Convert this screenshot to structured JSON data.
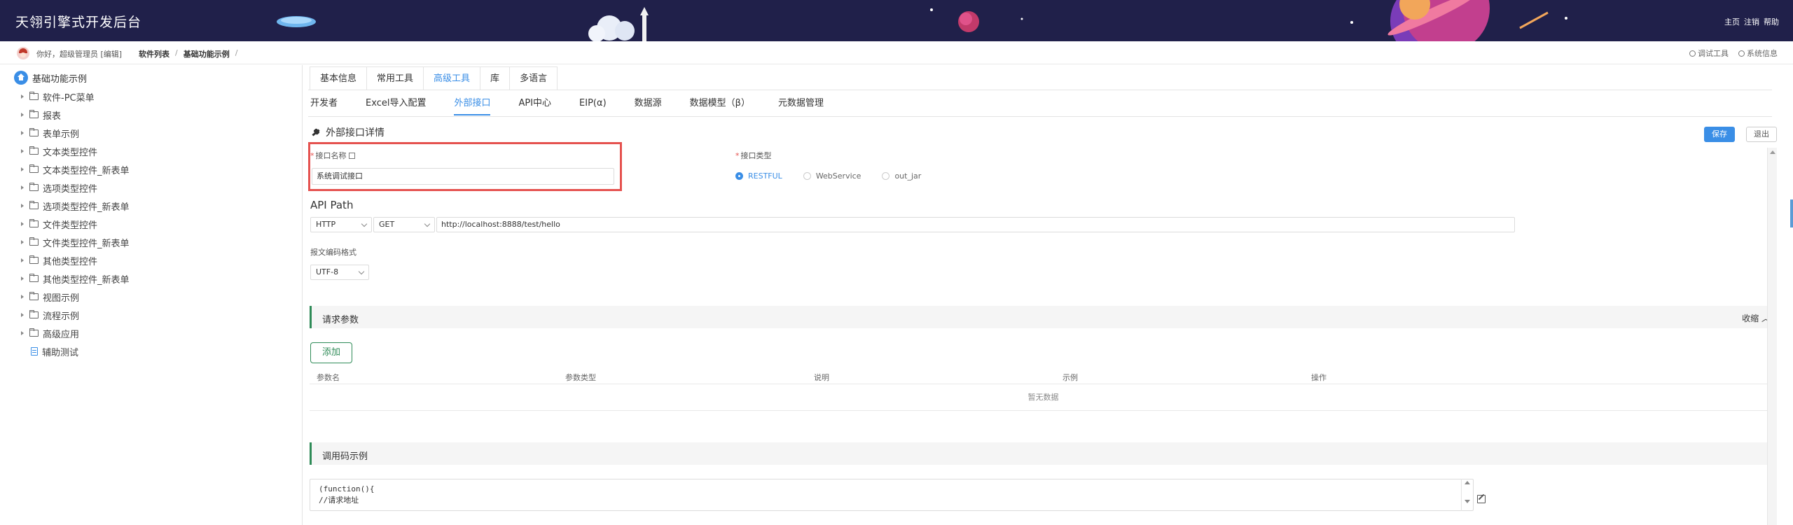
{
  "app": {
    "title": "天翎引擎式开发后台"
  },
  "header_links": [
    "主页",
    "注销",
    "帮助"
  ],
  "topbar": {
    "greeting": "你好，超级管理员 [编辑]",
    "breadcrumb": [
      "软件列表",
      "基础功能示例"
    ],
    "separators": [
      "/",
      "/"
    ],
    "tools": [
      {
        "label": "调试工具",
        "icon": "debug-icon"
      },
      {
        "label": "系统信息",
        "icon": "gear-icon"
      }
    ]
  },
  "sidebar": {
    "root": "基础功能示例",
    "items": [
      {
        "label": "软件-PC菜单",
        "icon": "folder-icon"
      },
      {
        "label": "报表",
        "icon": "folder-icon"
      },
      {
        "label": "表单示例",
        "icon": "folder-icon"
      },
      {
        "label": "文本类型控件",
        "icon": "folder-icon"
      },
      {
        "label": "文本类型控件_新表单",
        "icon": "folder-icon"
      },
      {
        "label": "选项类型控件",
        "icon": "folder-icon"
      },
      {
        "label": "选项类型控件_新表单",
        "icon": "folder-icon"
      },
      {
        "label": "文件类型控件",
        "icon": "folder-icon"
      },
      {
        "label": "文件类型控件_新表单",
        "icon": "folder-icon"
      },
      {
        "label": "其他类型控件",
        "icon": "folder-icon"
      },
      {
        "label": "其他类型控件_新表单",
        "icon": "folder-icon"
      },
      {
        "label": "视图示例",
        "icon": "folder-icon"
      },
      {
        "label": "流程示例",
        "icon": "folder-icon"
      },
      {
        "label": "高级应用",
        "icon": "folder-icon"
      },
      {
        "label": "辅助测试",
        "icon": "doc-icon"
      }
    ]
  },
  "tabs_primary": [
    {
      "label": "基本信息"
    },
    {
      "label": "常用工具"
    },
    {
      "label": "高级工具",
      "active": true
    },
    {
      "label": "库"
    },
    {
      "label": "多语言"
    }
  ],
  "tabs_secondary": [
    {
      "label": "开发者"
    },
    {
      "label": "Excel导入配置"
    },
    {
      "label": "外部接口",
      "active": true
    },
    {
      "label": "API中心"
    },
    {
      "label": "EIP(α)"
    },
    {
      "label": "数据源"
    },
    {
      "label": "数据模型（β）"
    },
    {
      "label": "元数据管理"
    }
  ],
  "detail": {
    "title": "外部接口详情",
    "save_label": "保存",
    "exit_label": "退出",
    "name_label": "接口名称",
    "name_value": "系统调试接口",
    "type_label": "接口类型",
    "type_options": [
      {
        "label": "RESTFUL",
        "selected": true
      },
      {
        "label": "WebService",
        "selected": false
      },
      {
        "label": "out_jar",
        "selected": false
      }
    ],
    "api_path_label": "API Path",
    "protocol": "HTTP",
    "method": "GET",
    "url": "http://localhost:8888/test/hello",
    "encoding_label": "报文编码格式",
    "encoding": "UTF-8"
  },
  "request_params": {
    "title": "请求参数",
    "collapse_label": "收缩",
    "add_label": "添加",
    "columns": [
      "参数名",
      "参数类型",
      "说明",
      "示例",
      "操作"
    ],
    "empty_text": "暂无数据"
  },
  "code_example": {
    "title": "调用码示例",
    "lines": [
      "(function(){",
      "//请求地址"
    ]
  },
  "colors": {
    "header_bg": "#20204a",
    "accent": "#3a8ee6",
    "panel_accent": "#2e8b57",
    "highlight": "#e5524f"
  }
}
